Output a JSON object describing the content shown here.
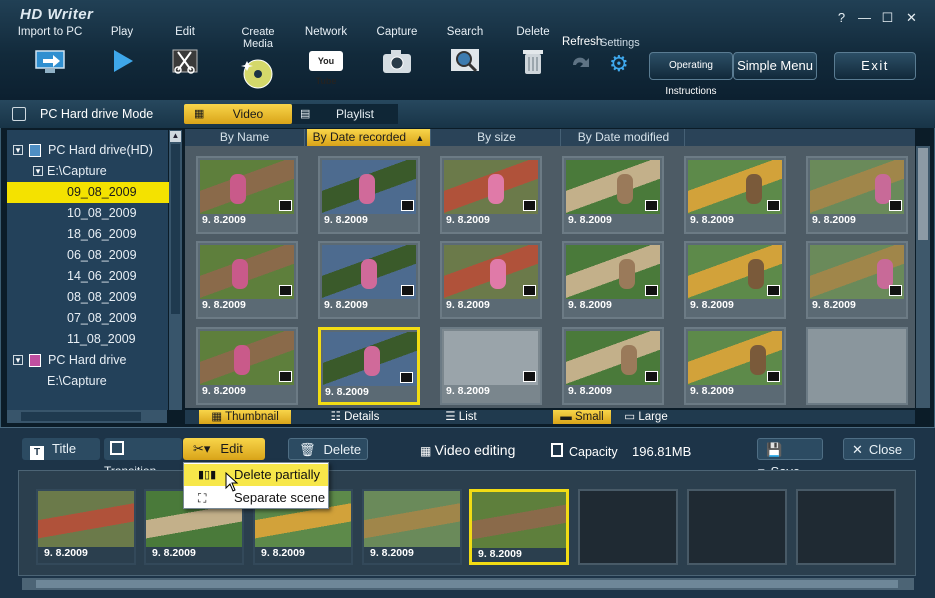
{
  "app": {
    "title": "HD Writer"
  },
  "toolbar": {
    "import": "Import to PC",
    "play": "Play",
    "edit": "Edit",
    "create_media": "Create Media",
    "network": "Network",
    "capture": "Capture",
    "search": "Search",
    "delete": "Delete",
    "refresh": "Refresh",
    "settings": "Settings",
    "youtube": "You Tube",
    "operating_instructions": "Operating Instructions",
    "simple_menu": "Simple Menu",
    "exit": "Exit"
  },
  "mode": {
    "label": "PC Hard drive Mode",
    "tab_video": "Video",
    "tab_playlist": "Playlist"
  },
  "tree": {
    "root1": "PC Hard drive(HD)",
    "folder1": "E:\\Capture",
    "items": [
      "09_08_2009",
      "10_08_2009",
      "18_06_2009",
      "06_08_2009",
      "14_06_2009",
      "08_08_2009",
      "07_08_2009",
      "11_08_2009"
    ],
    "root2": "PC Hard drive",
    "folder2": "E:\\Capture"
  },
  "sort": {
    "by_name": "By Name",
    "by_date": "By Date recorded",
    "by_size": "By size",
    "by_modified": "By Date modified"
  },
  "thumbnails": [
    {
      "date": "9. 8.2009"
    },
    {
      "date": "9. 8.2009"
    },
    {
      "date": "9. 8.2009"
    },
    {
      "date": "9. 8.2009"
    },
    {
      "date": "9. 8.2009"
    },
    {
      "date": "9. 8.2009"
    },
    {
      "date": "9. 8.2009"
    },
    {
      "date": "9. 8.2009"
    },
    {
      "date": "9. 8.2009"
    },
    {
      "date": "9. 8.2009"
    },
    {
      "date": "9. 8.2009"
    },
    {
      "date": "9. 8.2009"
    },
    {
      "date": "9. 8.2009"
    },
    {
      "date": "9. 8.2009"
    },
    {
      "date": "9. 8.2009"
    },
    {
      "date": "9. 8.2009"
    },
    {
      "date": "9. 8.2009"
    }
  ],
  "view": {
    "thumbnail": "Thumbnail",
    "details": "Details",
    "list": "List",
    "small": "Small",
    "large": "Large"
  },
  "edit_panel": {
    "title": "Title",
    "transition": "Transition",
    "edit": "Edit",
    "delete": "Delete",
    "video_editing": "Video editing",
    "capacity_label": "Capacity",
    "capacity_value": "196.81MB",
    "save": "Save",
    "close": "Close"
  },
  "edit_menu": {
    "delete_partially": "Delete partially",
    "separate_scene": "Separate scene"
  },
  "clips": [
    {
      "date": "9. 8.2009"
    },
    {
      "date": "9. 8.2009"
    },
    {
      "date": "9. 8.2009"
    },
    {
      "date": "9. 8.2009"
    },
    {
      "date": "9. 8.2009"
    }
  ],
  "colors": {
    "accent": "#f2dc14",
    "toolbar": "#122a3b",
    "panel": "#23415a"
  }
}
